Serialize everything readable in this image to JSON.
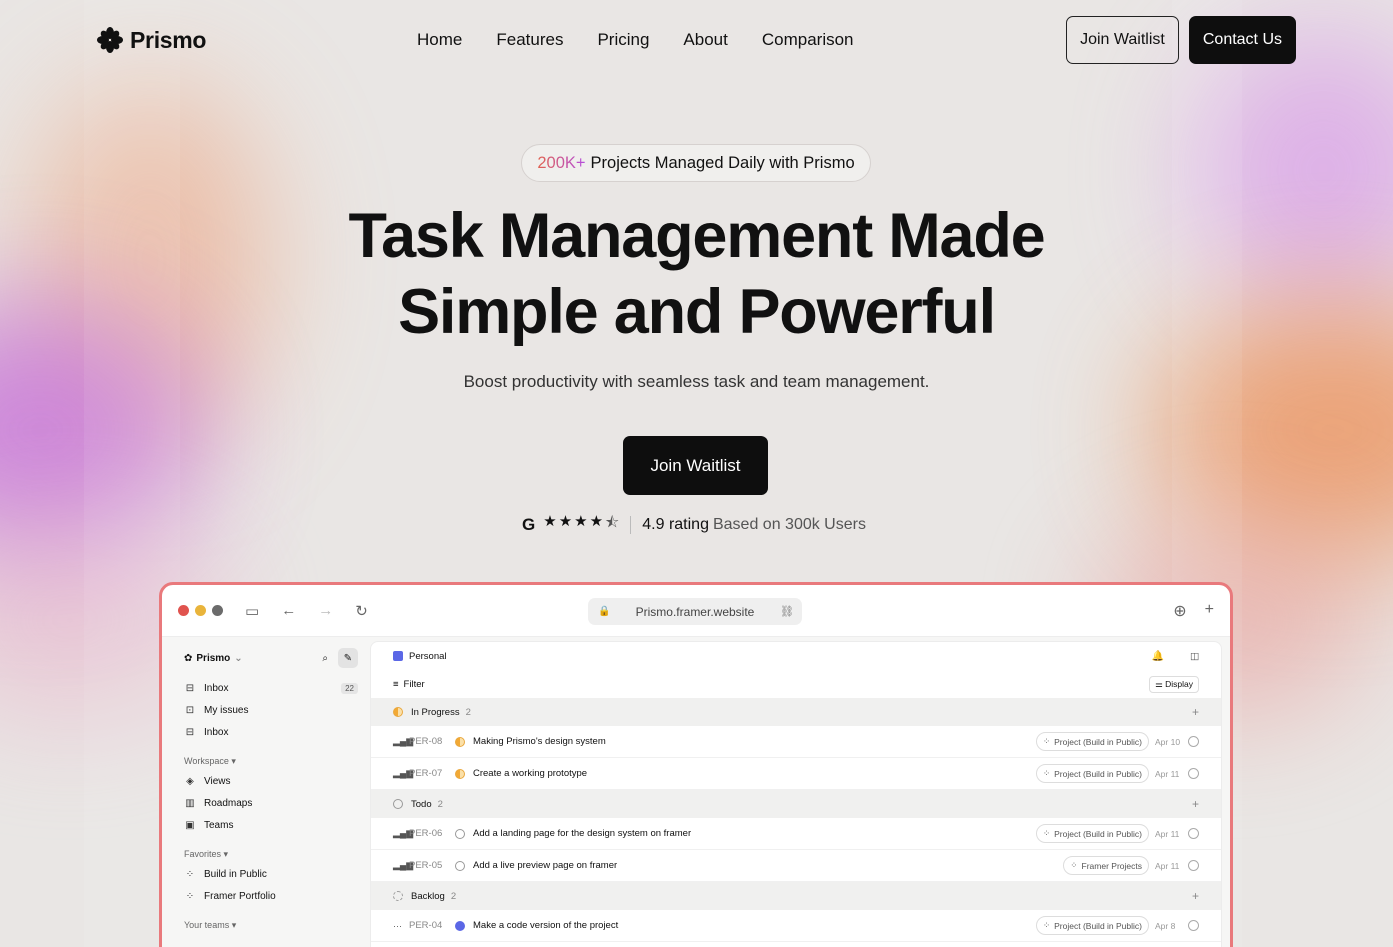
{
  "brand": {
    "name": "Prismo"
  },
  "nav": {
    "links": [
      "Home",
      "Features",
      "Pricing",
      "About",
      "Comparison"
    ],
    "join_label": "Join Waitlist",
    "contact_label": "Contact Us"
  },
  "hero": {
    "badge_highlight": "200K+",
    "badge_text": "Projects Managed Daily with Prismo",
    "title_line1": "Task Management Made",
    "title_line2": "Simple and Powerful",
    "subtitle": "Boost productivity with seamless task and team management.",
    "cta_label": "Join Waitlist",
    "rating_value": "4.9 rating",
    "rating_text": "Based on 300k Users",
    "rating_source_icon": "google-icon",
    "stars": 4.5
  },
  "browser": {
    "url": "Prismo.framer.website"
  },
  "app": {
    "workspace_name": "Prismo",
    "sidebar": {
      "top_items": [
        {
          "label": "Inbox",
          "icon": "inbox-icon",
          "count": "22"
        },
        {
          "label": "My issues",
          "icon": "target-icon"
        },
        {
          "label": "Inbox",
          "icon": "inbox-icon"
        }
      ],
      "workspace_label": "Workspace",
      "workspace_items": [
        {
          "label": "Views",
          "icon": "layers-icon"
        },
        {
          "label": "Roadmaps",
          "icon": "map-icon"
        },
        {
          "label": "Teams",
          "icon": "team-icon"
        }
      ],
      "favorites_label": "Favorites",
      "favorite_items": [
        {
          "label": "Build in Public",
          "icon": "grid-icon"
        },
        {
          "label": "Framer Portfolio",
          "icon": "grid-icon"
        }
      ],
      "teams_label": "Your teams"
    },
    "main": {
      "title": "Personal",
      "filter_label": "Filter",
      "display_label": "Display",
      "groups": [
        {
          "name": "In Progress",
          "count": "2",
          "status": "progress",
          "issues": [
            {
              "id": "PER-08",
              "title": "Making Prismo's design system",
              "tag": "Project (Build in Public)",
              "date": "Apr 10",
              "status": "progress"
            },
            {
              "id": "PER-07",
              "title": "Create a working prototype",
              "tag": "Project (Build in Public)",
              "date": "Apr 11",
              "status": "progress"
            }
          ]
        },
        {
          "name": "Todo",
          "count": "2",
          "status": "todo",
          "issues": [
            {
              "id": "PER-06",
              "title": "Add a landing page for the design system on framer",
              "tag": "Project (Build in Public)",
              "date": "Apr 11",
              "status": "todo"
            },
            {
              "id": "PER-05",
              "title": "Add a live preview page on framer",
              "tag": "Framer Projects",
              "date": "Apr 11",
              "status": "todo"
            }
          ]
        },
        {
          "name": "Backlog",
          "count": "2",
          "status": "backlog",
          "issues": [
            {
              "id": "PER-04",
              "title": "Make a code version of the project",
              "tag": "Project (Build in Public)",
              "date": "Apr 8",
              "status": "done"
            }
          ]
        }
      ]
    }
  }
}
